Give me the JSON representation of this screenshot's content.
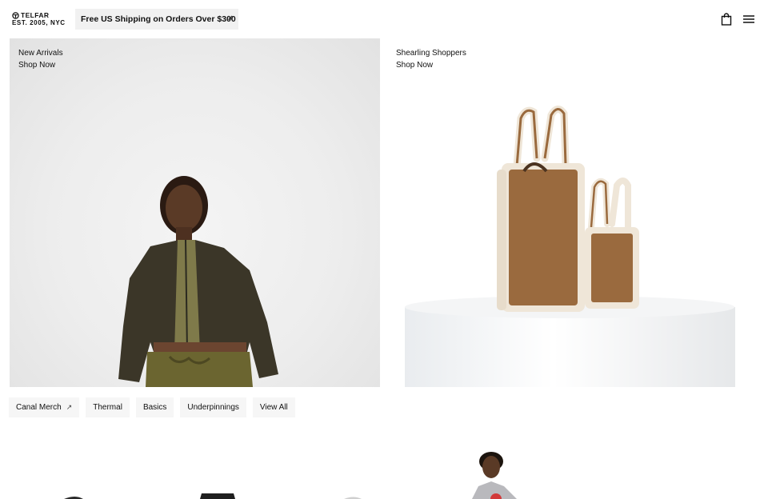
{
  "brand": {
    "name": "TELFAR",
    "tagline": "EST. 2005, NYC"
  },
  "announcement": {
    "text": "Free US Shipping on Orders Over $300",
    "close_symbol": "×"
  },
  "header_icons": [
    "bag-icon",
    "menu-icon"
  ],
  "hero": {
    "left": {
      "title": "New Arrivals",
      "cta": "Shop Now"
    },
    "right": {
      "title": "Shearling Shoppers",
      "cta": "Shop Now"
    }
  },
  "categories": [
    {
      "label": "Canal Merch",
      "external": true
    },
    {
      "label": "Thermal"
    },
    {
      "label": "Basics"
    },
    {
      "label": "Underpinnings"
    },
    {
      "label": "View All"
    }
  ],
  "colors": {
    "shearling_brown": "#9a6a3e",
    "shearling_cream": "#efe6d8",
    "jacket": "#3d3a2c",
    "olive": "#7f7a4a"
  }
}
